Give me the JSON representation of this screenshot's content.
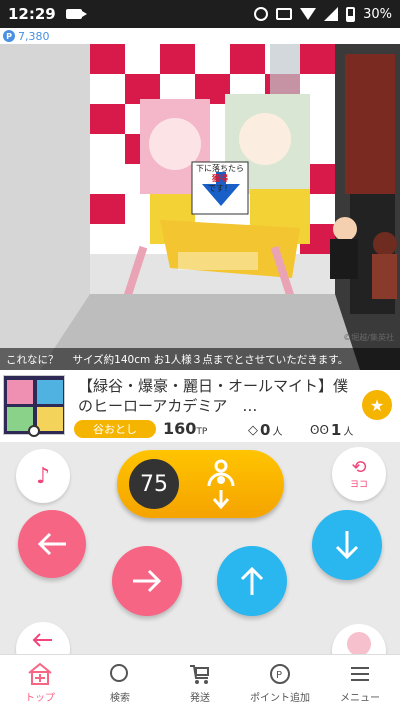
{
  "status_bar": {
    "time": "12:29",
    "battery": "30%"
  },
  "points": {
    "value": "7,380"
  },
  "camera": {
    "caption_question": "これなに？",
    "caption_text": "サイズ約140cm お1人様３点までとさせていただきます。",
    "watermark": "©堀越/集英社",
    "sign_line1": "下に落ちたら",
    "sign_line2": "獲得",
    "sign_line3": "です！"
  },
  "product": {
    "title": "【緑谷・爆豪・麗日・オールマイト】僕のヒーローアカデミア　…",
    "tag": "谷おとし",
    "price": "160",
    "price_unit": "TP",
    "players": "0",
    "players_unit": "人",
    "watchers": "1",
    "watchers_unit": "人"
  },
  "controls": {
    "countdown": "75",
    "side_label": "ヨコ"
  },
  "nav": {
    "items": [
      {
        "label": "トップ"
      },
      {
        "label": "検索"
      },
      {
        "label": "発送"
      },
      {
        "label": "ポイント追加"
      },
      {
        "label": "メニュー"
      }
    ]
  }
}
